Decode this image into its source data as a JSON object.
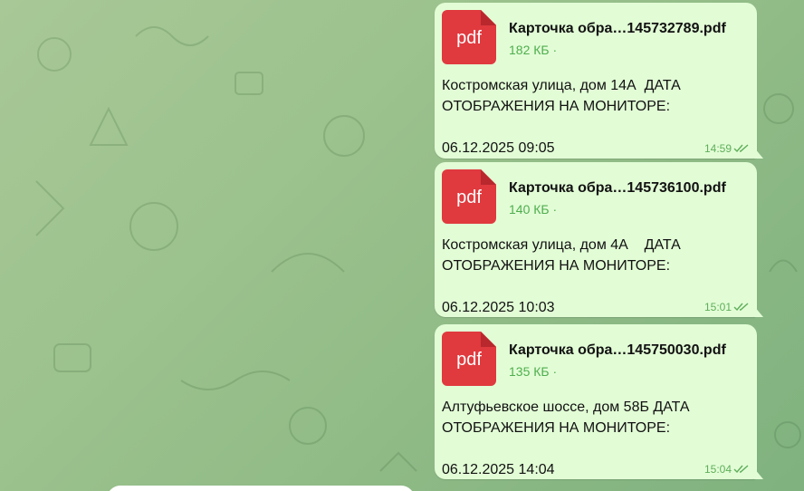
{
  "colors": {
    "bubble": "#e2fdd6",
    "pdf_icon": "#e0393e",
    "meta_green": "#5fae5a"
  },
  "messages": [
    {
      "file_icon_label": "pdf",
      "file_name": "Карточка обра…145732789.pdf",
      "file_size": "182 КБ ·",
      "text": "Костромская улица, дом 14А  ДАТА ОТОБРАЖЕНИЯ НА МОНИТОРЕ:\n\n06.12.2025 09:05",
      "time": "14:59",
      "status_icon": "double-check-icon"
    },
    {
      "file_icon_label": "pdf",
      "file_name": "Карточка обра…145736100.pdf",
      "file_size": "140 КБ ·",
      "text": "Костромская улица, дом 4А    ДАТА ОТОБРАЖЕНИЯ НА МОНИТОРЕ:\n\n06.12.2025 10:03",
      "time": "15:01",
      "status_icon": "double-check-icon"
    },
    {
      "file_icon_label": "pdf",
      "file_name": "Карточка обра…145750030.pdf",
      "file_size": "135 КБ ·",
      "text": "Алтуфьевское шоссе, дом 58Б ДАТА ОТОБРАЖЕНИЯ НА МОНИТОРЕ:\n\n06.12.2025 14:04",
      "time": "15:04",
      "status_icon": "double-check-icon"
    }
  ]
}
